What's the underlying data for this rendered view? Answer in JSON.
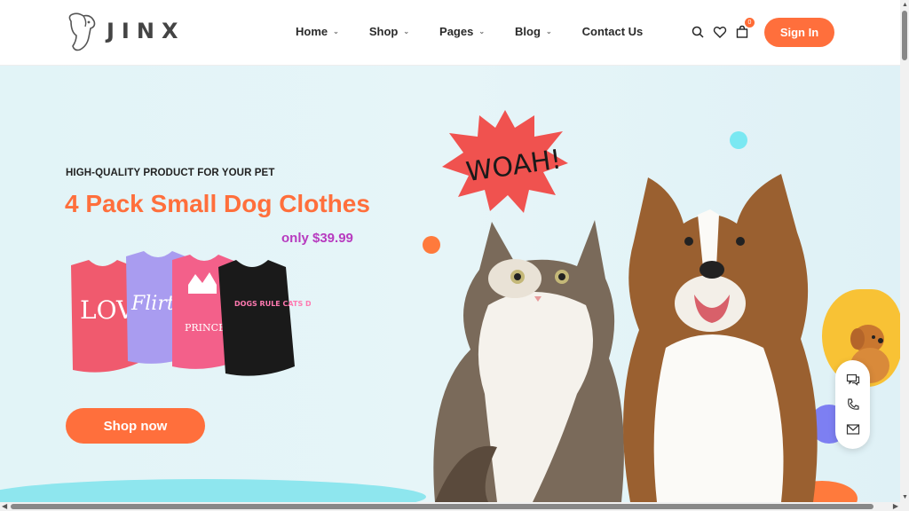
{
  "brand": {
    "name": "JINX"
  },
  "nav": {
    "items": [
      {
        "label": "Home",
        "has_dropdown": true
      },
      {
        "label": "Shop",
        "has_dropdown": true
      },
      {
        "label": "Pages",
        "has_dropdown": true
      },
      {
        "label": "Blog",
        "has_dropdown": true
      },
      {
        "label": "Contact Us",
        "has_dropdown": false
      }
    ],
    "chevron": "⌄"
  },
  "header_icons": {
    "search": "search-icon",
    "wishlist": "heart-icon",
    "cart": "cart-icon",
    "cart_count": "0"
  },
  "signin": {
    "label": "Sign In"
  },
  "hero": {
    "eyebrow": "HIGH-QUALITY PRODUCT FOR YOUR PET",
    "headline": "4 Pack Small Dog Clothes",
    "price": "only $39.99",
    "cta": "Shop now",
    "starburst_text": "WOAH!",
    "shirts": [
      "LOVE",
      "Flirt",
      "PRINCESS",
      "DOGS RULE CATS DROOL"
    ]
  },
  "contact_bar": {
    "items": [
      "chat-icon",
      "phone-icon",
      "mail-icon"
    ]
  },
  "colors": {
    "accent": "#ff6f3c",
    "price": "#b73bbf",
    "hero_bg": "#e2f4f7"
  }
}
